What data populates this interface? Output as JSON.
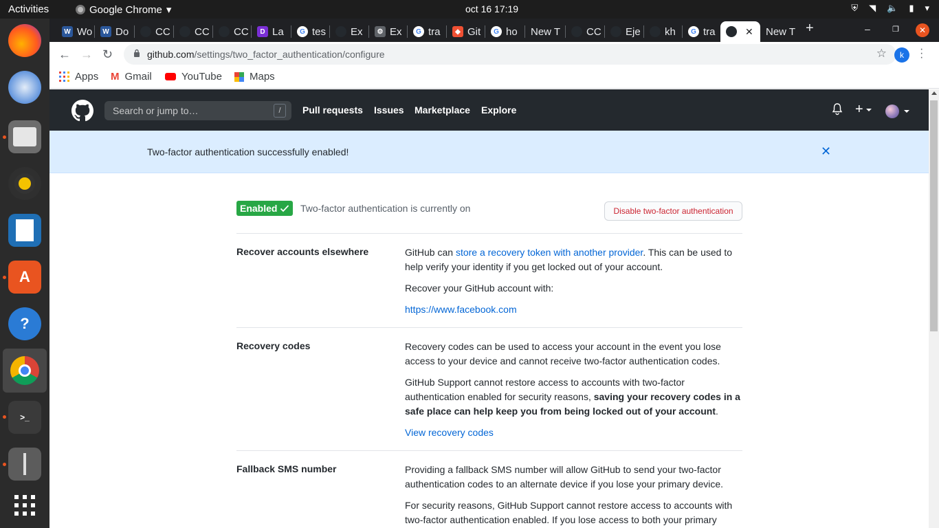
{
  "os": {
    "activities": "Activities",
    "app_name": "Google Chrome",
    "clock": "oct 16  17:19"
  },
  "browser": {
    "tabs": [
      {
        "label": "Wo",
        "icon": "word-icon",
        "color": "#2b579a"
      },
      {
        "label": "Do",
        "icon": "word-icon",
        "color": "#2b579a"
      },
      {
        "label": "CC",
        "icon": "github-icon",
        "color": "#24292e"
      },
      {
        "label": "CC",
        "icon": "github-icon",
        "color": "#24292e"
      },
      {
        "label": "CC",
        "icon": "github-icon",
        "color": "#24292e"
      },
      {
        "label": "La",
        "icon": "app-icon",
        "color": "#7b2fd6"
      },
      {
        "label": "tes",
        "icon": "google-icon",
        "color": "#4285f4"
      },
      {
        "label": "Ex",
        "icon": "github-icon",
        "color": "#24292e"
      },
      {
        "label": "Ex",
        "icon": "gear-icon",
        "color": "#5f6368"
      },
      {
        "label": "tra",
        "icon": "google-icon",
        "color": "#4285f4"
      },
      {
        "label": "Git",
        "icon": "git-icon",
        "color": "#f05033"
      },
      {
        "label": "ho",
        "icon": "google-icon",
        "color": "#4285f4"
      },
      {
        "label": "New T",
        "icon": "none",
        "color": "#202124"
      },
      {
        "label": "CC",
        "icon": "github-icon",
        "color": "#24292e"
      },
      {
        "label": "Eje",
        "icon": "github-icon",
        "color": "#24292e"
      },
      {
        "label": "kh",
        "icon": "github-icon",
        "color": "#24292e"
      },
      {
        "label": "tra",
        "icon": "google-icon",
        "color": "#4285f4"
      }
    ],
    "active_tab_icon": "github-icon",
    "after_tab": "New T",
    "url_host": "github.com",
    "url_path": "/settings/two_factor_authentication/configure",
    "profile_initial": "k",
    "bookmarks": {
      "apps": "Apps",
      "gmail": "Gmail",
      "youtube": "YouTube",
      "maps": "Maps"
    }
  },
  "github": {
    "search_placeholder": "Search or jump to…",
    "search_shortcut": "/",
    "nav": {
      "pull_requests": "Pull requests",
      "issues": "Issues",
      "marketplace": "Marketplace",
      "explore": "Explore"
    },
    "flash": "Two-factor authentication successfully enabled!",
    "status": {
      "badge": "Enabled",
      "text": "Two-factor authentication is currently on",
      "disable_button": "Disable two-factor authentication"
    },
    "recover": {
      "label": "Recover accounts elsewhere",
      "p1_pre": "GitHub can ",
      "p1_link": "store a recovery token with another provider",
      "p1_post": ". This can be used to help verify your identity if you get locked out of your account.",
      "p2": "Recover your GitHub account with:",
      "provider_link": "https://www.facebook.com"
    },
    "recovery_codes": {
      "label": "Recovery codes",
      "p1": "Recovery codes can be used to access your account in the event you lose access to your device and cannot receive two-factor authentication codes.",
      "p2_pre": "GitHub Support cannot restore access to accounts with two-factor authentication enabled for security reasons, ",
      "p2_bold": "saving your recovery codes in a safe place can help keep you from being locked out of your account",
      "p2_post": ".",
      "view_link": "View recovery codes"
    },
    "sms": {
      "label": "Fallback SMS number",
      "p1": "Providing a fallback SMS number will allow GitHub to send your two-factor authentication codes to an alternate device if you lose your primary device.",
      "p2": "For security reasons, GitHub Support cannot restore access to accounts with two-factor authentication enabled. If you lose access to both your primary"
    }
  }
}
